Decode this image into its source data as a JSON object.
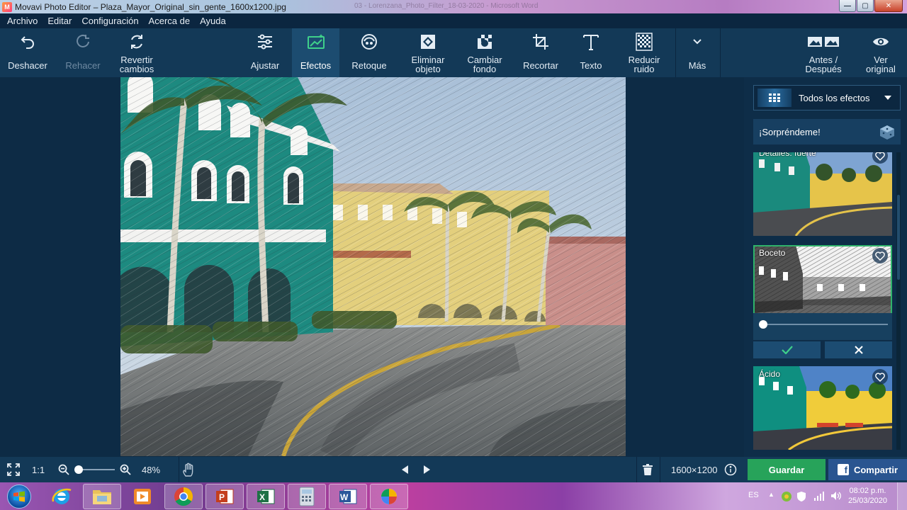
{
  "window": {
    "title": "Movavi Photo Editor – Plaza_Mayor_Original_sin_gente_1600x1200.jpg",
    "background_title": "03 - Lorenzana_Photo_Filter_18-03-2020 - Microsoft Word",
    "controls": {
      "minimize": "—",
      "maximize": "▢",
      "close": "✕"
    }
  },
  "menu": [
    "Archivo",
    "Editar",
    "Configuración",
    "Acerca de",
    "Ayuda"
  ],
  "toolbar": {
    "undo": "Deshacer",
    "redo": "Rehacer",
    "revert": "Revertir\ncambios",
    "adjust": "Ajustar",
    "effects": "Efectos",
    "retouch": "Retoque",
    "remove_object": "Eliminar\nobjeto",
    "change_bg": "Cambiar\nfondo",
    "crop": "Recortar",
    "text": "Texto",
    "denoise": "Reducir\nruido",
    "more": "Más",
    "before_after": "Antes /\nDespués",
    "view_original": "Ver\noriginal"
  },
  "panel": {
    "effects_dropdown": "Todos los efectos",
    "surprise": "¡Sorpréndeme!",
    "effects": [
      {
        "name": "Detalles: fuerte"
      },
      {
        "name": "Boceto",
        "selected": true,
        "intensity": 0.05
      },
      {
        "name": "Ácido"
      }
    ],
    "apply": "✓",
    "cancel": "✕"
  },
  "bottom": {
    "ratio": "1:1",
    "zoom": "48%",
    "zoom_level": 0.48,
    "dimensions": "1600×1200",
    "save": "Guardar",
    "share": "Compartir"
  },
  "taskbar": {
    "apps": [
      "internet-explorer",
      "file-explorer",
      "media-player",
      "chrome",
      "powerpoint",
      "excel",
      "calculator",
      "word",
      "paint"
    ],
    "language": "ES",
    "time": "08:02 p.m.",
    "date": "25/03/2020"
  },
  "colors": {
    "accent_active": "#1c4c70",
    "save": "#27a35a",
    "share": "#2a5590",
    "selected_outline": "#2fb36a"
  }
}
